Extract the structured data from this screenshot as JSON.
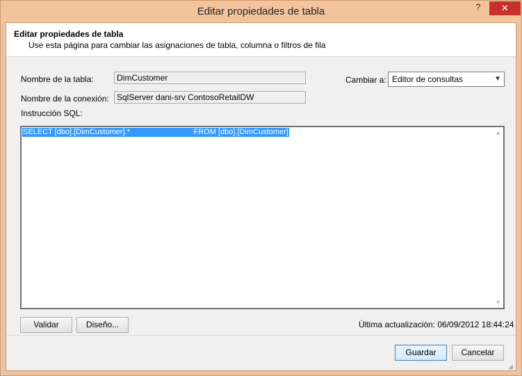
{
  "window": {
    "title": "Editar propiedades de tabla",
    "help_label": "?",
    "close_label": "✕"
  },
  "header": {
    "title": "Editar propiedades de tabla",
    "description": "Use esta página para cambiar las asignaciones de tabla, columna o filtros de fila"
  },
  "form": {
    "table_name_label": "Nombre de la tabla:",
    "table_name_value": "DimCustomer",
    "connection_name_label": "Nombre de la conexión:",
    "connection_name_value": "SqlServer dani-srv ContosoRetailDW",
    "switch_to_label": "Cambiar a:",
    "switch_to_value": "Editor de consultas",
    "sql_label": "Instrucción SQL:",
    "sql_text": "SELECT [dbo].[DimCustomer].*                              FROM [dbo].[DimCustomer]"
  },
  "actions": {
    "validate_label": "Validar",
    "design_label": "Diseño...",
    "last_update": "Última actualización: 06/09/2012 18:44:24"
  },
  "footer": {
    "save_label": "Guardar",
    "cancel_label": "Cancelar"
  },
  "colors": {
    "title_bar": "#f3c49c",
    "close_button": "#c7312b",
    "selection": "#3399ff"
  }
}
